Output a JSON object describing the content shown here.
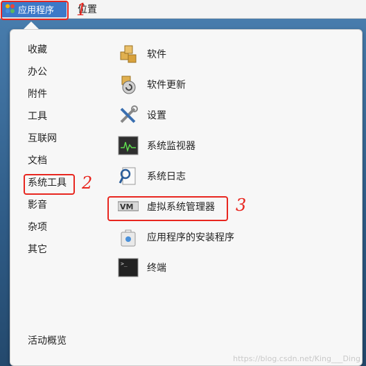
{
  "topbar": {
    "apps_label": "应用程序",
    "places_label": "位置"
  },
  "annotations": {
    "one": "1",
    "two": "2",
    "three": "3"
  },
  "categories": [
    "收藏",
    "办公",
    "附件",
    "工具",
    "互联网",
    "文档",
    "系统工具",
    "影音",
    "杂项",
    "其它"
  ],
  "activities_label": "活动概览",
  "apps": [
    {
      "label": "软件",
      "icon": "software-icon"
    },
    {
      "label": "软件更新",
      "icon": "software-update-icon"
    },
    {
      "label": "设置",
      "icon": "settings-icon"
    },
    {
      "label": "系统监视器",
      "icon": "system-monitor-icon"
    },
    {
      "label": "系统日志",
      "icon": "system-log-icon"
    },
    {
      "label": "虚拟系统管理器",
      "icon": "virt-manager-icon"
    },
    {
      "label": "应用程序的安装程序",
      "icon": "app-installer-icon"
    },
    {
      "label": "终端",
      "icon": "terminal-icon"
    }
  ],
  "watermark": "https://blog.csdn.net/King___Ding"
}
